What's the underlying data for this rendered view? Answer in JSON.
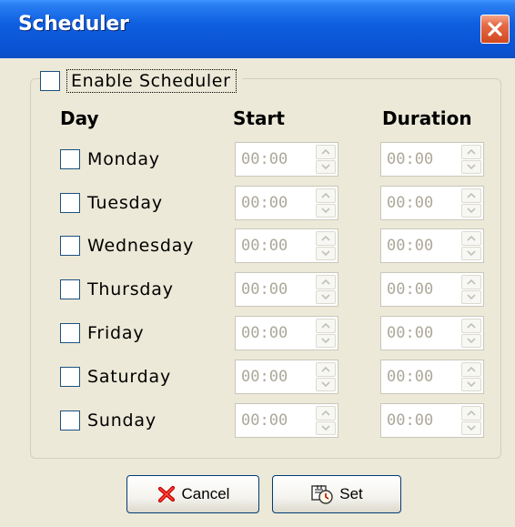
{
  "window": {
    "title": "Scheduler"
  },
  "enable": {
    "label": "Enable Scheduler",
    "checked": false
  },
  "headers": {
    "day": "Day",
    "start": "Start",
    "duration": "Duration"
  },
  "days": [
    {
      "label": "Monday",
      "start": "00:00",
      "duration": "00:00"
    },
    {
      "label": "Tuesday",
      "start": "00:00",
      "duration": "00:00"
    },
    {
      "label": "Wednesday",
      "start": "00:00",
      "duration": "00:00"
    },
    {
      "label": "Thursday",
      "start": "00:00",
      "duration": "00:00"
    },
    {
      "label": "Friday",
      "start": "00:00",
      "duration": "00:00"
    },
    {
      "label": "Saturday",
      "start": "00:00",
      "duration": "00:00"
    },
    {
      "label": "Sunday",
      "start": "00:00",
      "duration": "00:00"
    }
  ],
  "buttons": {
    "cancel": "Cancel",
    "set": "Set"
  },
  "colors": {
    "titlebar": "#0a55d6",
    "close": "#d2481f",
    "dialog": "#ece9d8",
    "disabled_text": "#aca899"
  }
}
